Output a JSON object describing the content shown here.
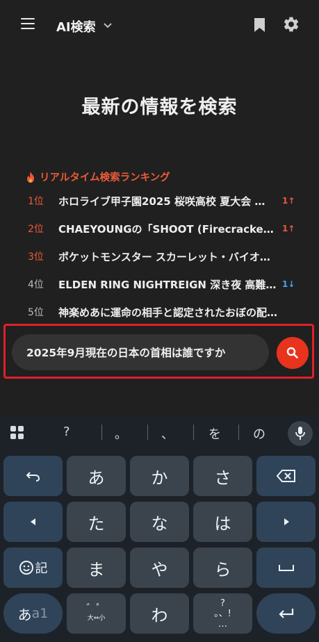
{
  "header": {
    "title": "AI検索"
  },
  "hero": {
    "title": "最新の情報を検索"
  },
  "ranking": {
    "title": "リアルタイム検索ランキング",
    "items": [
      {
        "rank": "1位",
        "text": "ホロライブ甲子園2025 桜咲高校 夏大会 …",
        "badge": "1↑"
      },
      {
        "rank": "2位",
        "text": "CHAEYOUNGの「SHOOT (Firecracke…",
        "badge": "1↑"
      },
      {
        "rank": "3位",
        "text": "ポケットモンスター スカーレット・バイオ…",
        "badge": ""
      },
      {
        "rank": "4位",
        "text": "ELDEN RING NIGHTREIGN 深き夜 高難…",
        "badge": "1↓"
      },
      {
        "rank": "5位",
        "text": "神楽めあに運命の相手と認定されたおぼの配…",
        "badge": ""
      }
    ]
  },
  "search": {
    "value": "2025年9月現在の日本の首相は誰ですか"
  },
  "keyboard": {
    "suggestions": [
      "?",
      "。",
      "、",
      "を",
      "の"
    ],
    "rows": [
      [
        "↶",
        "あ",
        "か",
        "さ",
        "⌫"
      ],
      [
        "◀",
        "た",
        "な",
        "は",
        "▶"
      ],
      [
        "☺記",
        "ま",
        "や",
        "ら",
        "␣"
      ],
      [
        "あa1",
        "゛゜\n大⇔小",
        "わ",
        "?\n。、!\n…",
        "↵"
      ]
    ],
    "row4": {
      "mode": "あ",
      "mode_sub": "a1",
      "dakuten": "゛゜",
      "dakuten_sub": "大⇔小",
      "wa": "わ",
      "punct_top": "?",
      "punct_mid": "。、!",
      "punct_bot": "…"
    },
    "emoji_label": "記"
  },
  "colors": {
    "accent": "#e8331d",
    "rank_red": "#ef5a37",
    "up_red": "#ef5a37",
    "down_blue": "#4aa3f0",
    "highlight": "#e0202a"
  }
}
